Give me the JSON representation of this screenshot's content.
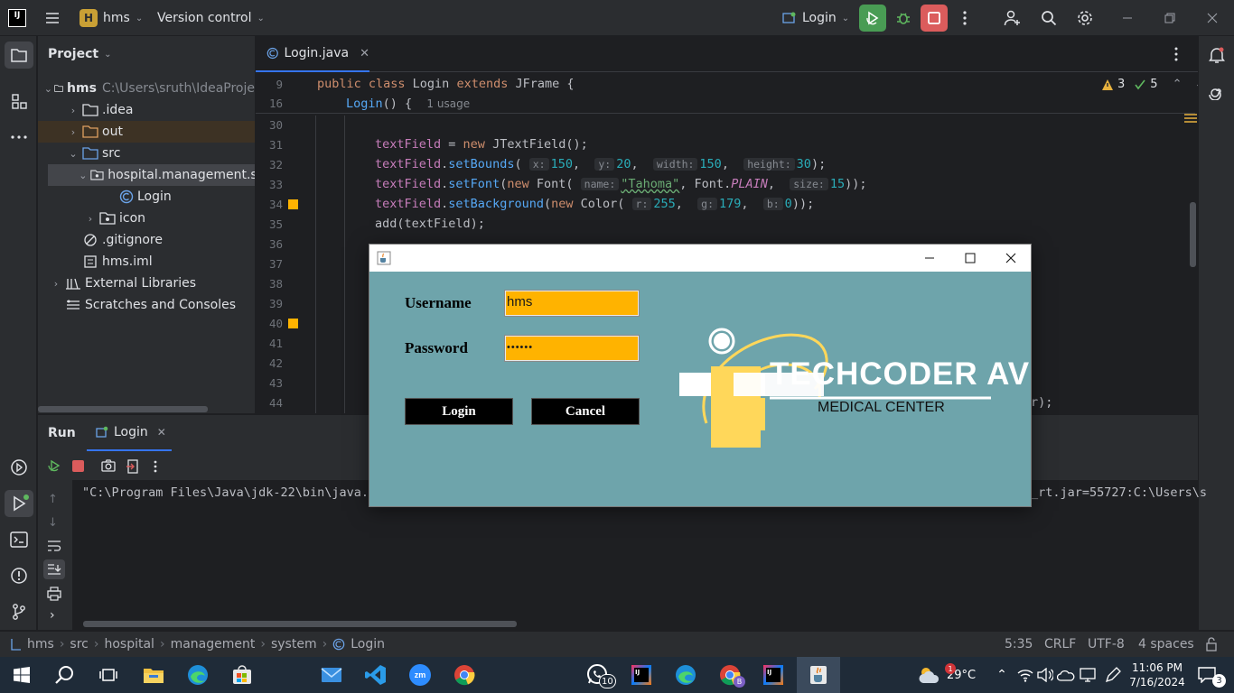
{
  "titlebar": {
    "project_badge": "H",
    "project_name": "hms",
    "vcs": "Version control",
    "run_config": "Login"
  },
  "project_panel": {
    "title": "Project",
    "root_name": "hms",
    "root_path": "C:\\Users\\sruth\\IdeaProje",
    "items": [
      {
        "label": "hms"
      },
      {
        "label": ".idea"
      },
      {
        "label": "out"
      },
      {
        "label": "src"
      },
      {
        "label": "hospital.management.sy"
      },
      {
        "label": "Login"
      },
      {
        "label": "icon"
      },
      {
        "label": ".gitignore"
      },
      {
        "label": "hms.iml"
      },
      {
        "label": "External Libraries"
      },
      {
        "label": "Scratches and Consoles"
      }
    ]
  },
  "editor": {
    "tab_label": "Login.java",
    "warnings": "3",
    "checks": "5",
    "sticky_lines": [
      {
        "num": "9",
        "text": "public class Login extends JFrame {"
      },
      {
        "num": "16",
        "text": "Login() {",
        "usage": "1 usage"
      }
    ],
    "line_numbers": [
      "30",
      "31",
      "32",
      "33",
      "34",
      "35",
      "36",
      "37",
      "38",
      "39",
      "40",
      "41",
      "42",
      "43",
      "44"
    ],
    "code": {
      "l31": "textField = new JTextField();",
      "l32_pre": "textField.setBounds(",
      "l32_hx": "x:",
      "l32_x": "150",
      "l32_hy": "y:",
      "l32_y": "20",
      "l32_hw": "width:",
      "l32_w": "150",
      "l32_hh": "height:",
      "l32_h": "30",
      "l33_pre": "textField.setFont(new Font(",
      "l33_hn": "name:",
      "l33_name": "\"Tahoma\"",
      "l33_mid": ", Font.",
      "l33_plain": "PLAIN",
      "l33_hs": "size:",
      "l33_size": "15",
      "l34_pre": "textField.setBackground(new Color(",
      "l34_hr": "r:",
      "l34_r": "255",
      "l34_hg": "g:",
      "l34_g": "179",
      "l34_hb": "b:",
      "l34_b": "0",
      "l35": "add(textField);",
      "l44_tail": "r);"
    }
  },
  "run_panel": {
    "title": "Run",
    "tab_label": "Login",
    "console_line": "\"C:\\Program Files\\Java\\jdk-22\\bin\\java.e",
    "console_tail": "_rt.jar=55727:C:\\Users\\s"
  },
  "swing_window": {
    "username_label": "Username",
    "username_value": "hms",
    "password_label": "Password",
    "password_value": "••••••",
    "login_button": "Login",
    "cancel_button": "Cancel",
    "logo_title": "TECHCODER AV",
    "logo_subtitle": "MEDICAL CENTER"
  },
  "statusbar": {
    "breadcrumbs": [
      "hms",
      "src",
      "hospital",
      "management",
      "system",
      "Login"
    ],
    "position": "5:35",
    "line_sep": "CRLF",
    "encoding": "UTF-8",
    "indent": "4 spaces"
  },
  "taskbar": {
    "weather_temp": "29°C",
    "weather_badge": "1",
    "time": "11:06 PM",
    "date": "7/16/2024",
    "notification_count": "3",
    "whatsapp_badge": "10",
    "chrome_profile": "B"
  },
  "colors": {
    "ide_bg": "#1e1f22",
    "panel_bg": "#2b2d30",
    "field_bg": "#ffb300",
    "swing_bg": "#6ea4ab",
    "run_green": "#499c54",
    "stop_red": "#db5c5c"
  }
}
